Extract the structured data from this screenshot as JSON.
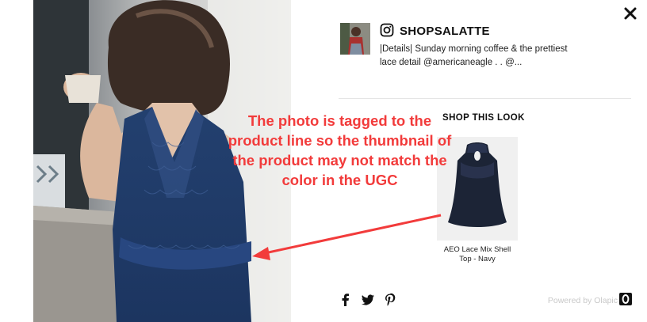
{
  "post": {
    "username": "SHOPSALATTE",
    "caption": "|Details| Sunday morning coffee & the prettiest lace detail @americaneagle . . @..."
  },
  "shop": {
    "title": "SHOP THIS LOOK",
    "product_name": "AEO Lace Mix Shell Top - Navy"
  },
  "footer": {
    "powered_by": "Powered by Olapic"
  },
  "annotation": {
    "text": "The photo is tagged to the product line so the thumbnail of the product may not match the color in the UGC"
  },
  "icons": {
    "close": "close-icon",
    "instagram": "instagram-icon",
    "facebook": "facebook-icon",
    "twitter": "twitter-icon",
    "pinterest": "pinterest-icon",
    "olapic": "olapic-logo-icon"
  },
  "colors": {
    "annotation_red": "#f23b3b",
    "top_navy": "#1f3b6a"
  }
}
